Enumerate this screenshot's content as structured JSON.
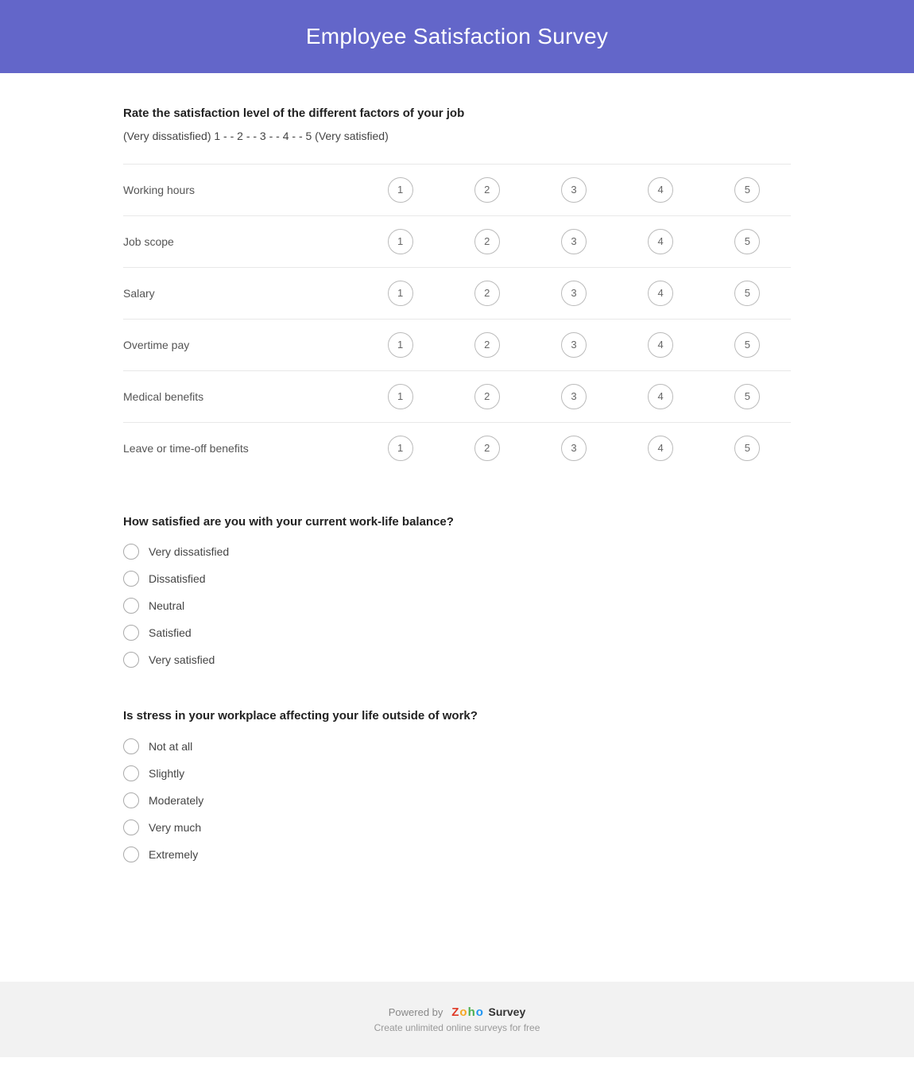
{
  "header": {
    "title": "Employee Satisfaction Survey"
  },
  "section1": {
    "question": "Rate the satisfaction level of the different factors of your job",
    "scale_hint": "(Very dissatisfied) 1 - - 2 - - 3 - - 4 - - 5 (Very satisfied)",
    "rows": [
      {
        "label": "Working hours"
      },
      {
        "label": "Job scope"
      },
      {
        "label": "Salary"
      },
      {
        "label": "Overtime pay"
      },
      {
        "label": "Medical benefits"
      },
      {
        "label": "Leave or time-off benefits"
      }
    ],
    "scale": [
      "1",
      "2",
      "3",
      "4",
      "5"
    ]
  },
  "section2": {
    "question": "How satisfied are you with your current work-life balance?",
    "options": [
      "Very dissatisfied",
      "Dissatisfied",
      "Neutral",
      "Satisfied",
      "Very satisfied"
    ]
  },
  "section3": {
    "question": "Is stress in your workplace affecting your life outside of work?",
    "options": [
      "Not at all",
      "Slightly",
      "Moderately",
      "Very much",
      "Extremely"
    ]
  },
  "footer": {
    "powered_by": "Powered by",
    "brand_z": "Z",
    "brand_o": "o",
    "brand_h": "h",
    "brand_o2": "o",
    "brand_survey": "Survey",
    "sub": "Create unlimited online surveys for free"
  }
}
